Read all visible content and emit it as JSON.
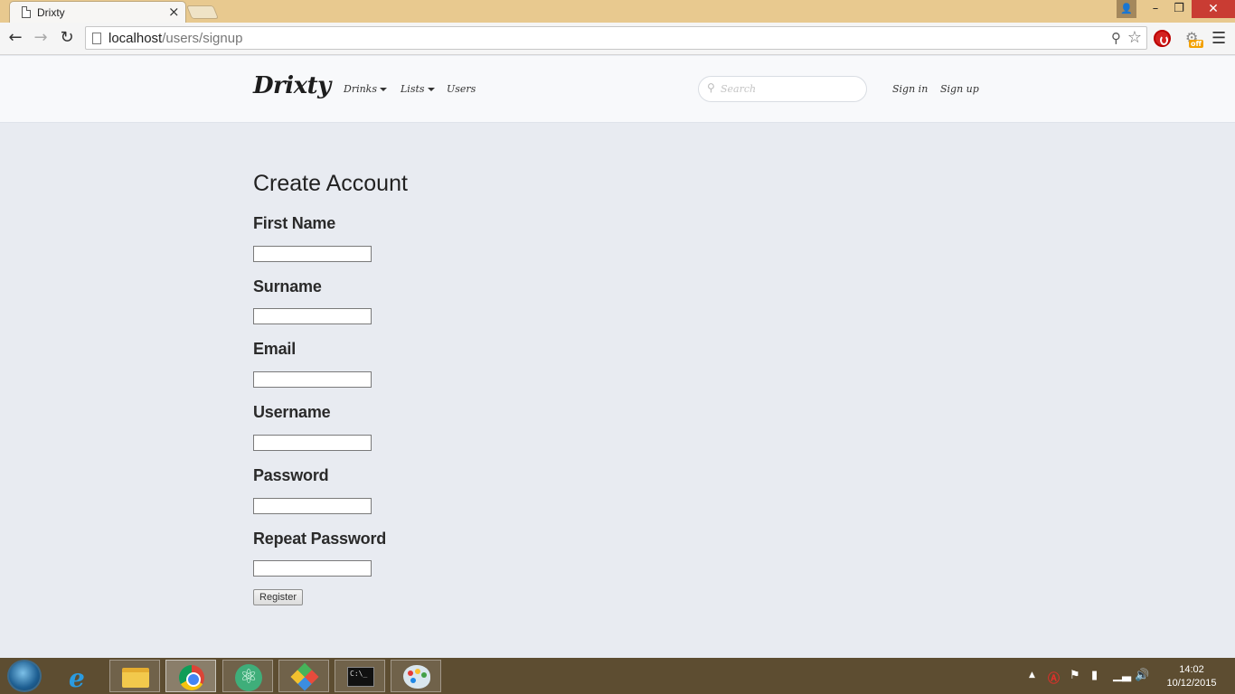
{
  "browser": {
    "tab_title": "Drixty",
    "tab_close": "×",
    "url_host": "localhost",
    "url_path": "/users/signup",
    "ext_off_badge": "off",
    "window": {
      "minimize": "–",
      "maximize": "❐",
      "close": "✕"
    }
  },
  "site": {
    "logo": "Drixty",
    "nav": [
      {
        "label": "Drinks",
        "has_dropdown": true
      },
      {
        "label": "Lists",
        "has_dropdown": true
      },
      {
        "label": "Users",
        "has_dropdown": false
      }
    ],
    "search_placeholder": "Search",
    "sign_in": "Sign in",
    "sign_up": "Sign up"
  },
  "form": {
    "title": "Create Account",
    "fields": [
      {
        "label": "First Name",
        "value": ""
      },
      {
        "label": "Surname",
        "value": ""
      },
      {
        "label": "Email",
        "value": ""
      },
      {
        "label": "Username",
        "value": ""
      },
      {
        "label": "Password",
        "value": ""
      },
      {
        "label": "Repeat Password",
        "value": ""
      }
    ],
    "submit_label": "Register"
  },
  "taskbar": {
    "apps": [
      "internet-explorer",
      "file-explorer",
      "chrome",
      "atom",
      "git-gui",
      "command-prompt",
      "paint"
    ],
    "active_app": "chrome",
    "clock_time": "14:02",
    "clock_date": "10/12/2015"
  },
  "colors": {
    "page_background": "#e8ebf1",
    "header_background": "#f8f9fb",
    "titlebar": "#e8c98f",
    "taskbar": "#5d4d31",
    "close_button": "#c93c33"
  }
}
